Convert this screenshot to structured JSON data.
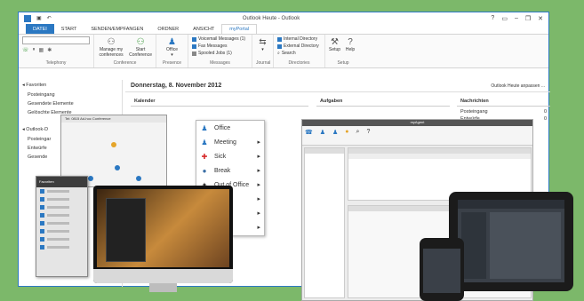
{
  "window": {
    "title": "Outlook Heute - Outlook",
    "controls": [
      "?",
      "▭",
      "–",
      "❐",
      "✕"
    ]
  },
  "tabs": [
    "DATEI",
    "START",
    "SENDEN/EMPFANGEN",
    "ORDNER",
    "ANSICHT",
    "myPortal"
  ],
  "ribbon": {
    "telephony_label": "Telephony",
    "conference": {
      "manage_label": "Manage my conferences",
      "start_label": "Start Conference",
      "group_label": "Conference"
    },
    "presence": {
      "office_label": "Office",
      "group_label": "Presence"
    },
    "messages": {
      "items": [
        "Voicemail Messages (1)",
        "Fax Messages",
        "Spooled Jobs (1)"
      ],
      "group_label": "Messages"
    },
    "journal": {
      "group_label": "Journal"
    },
    "directories": {
      "items": [
        "Internal Directory",
        "External Directory",
        "Search"
      ],
      "group_label": "Directories"
    },
    "setup": {
      "setup_label": "Setup",
      "help_label": "Help",
      "group_label": "Setup"
    }
  },
  "nav": {
    "favorites": "◂ Favoriten",
    "favorites_items": [
      "Posteingang",
      "Gesendete Elemente",
      "Gelöschte Elemente"
    ],
    "account": "◂ Outlook-D",
    "account_items": [
      "Posteingar",
      "Entwürfe",
      "Gesende"
    ]
  },
  "main": {
    "date": "Donnerstag, 8. November 2012",
    "customize": "Outlook Heute anpassen ...",
    "calendar": "Kalender",
    "tasks": "Aufgaben",
    "news": {
      "title": "Nachrichten",
      "rows": [
        {
          "label": "Posteingang",
          "value": "0"
        },
        {
          "label": "Entwürfe",
          "value": "0"
        }
      ]
    }
  },
  "status_menu": {
    "items": [
      {
        "label": "Office",
        "icon": "person-icon",
        "color": "#2b78c2"
      },
      {
        "label": "Meeting",
        "icon": "meeting-icon",
        "color": "#2b78c2"
      },
      {
        "label": "Sick",
        "icon": "cross-icon",
        "color": "#d62828"
      },
      {
        "label": "Break",
        "icon": "coffee-icon",
        "color": "#3a6ea5"
      },
      {
        "label": "Out of Office",
        "icon": "door-icon",
        "color": "#333333"
      },
      {
        "label": "...s",
        "icon": "",
        "color": ""
      },
      {
        "label": "",
        "icon": "",
        "color": ""
      },
      {
        "label": "",
        "icon": "",
        "color": ""
      }
    ]
  },
  "conference_window": {
    "title": "Tel: 0815 Ad-hoc Conference"
  },
  "cti_window": {
    "title": "myAgent"
  },
  "buddy_list": {
    "title": "Favoriten"
  },
  "colors": {
    "accent": "#2b78c2",
    "background": "#7cb86a"
  }
}
